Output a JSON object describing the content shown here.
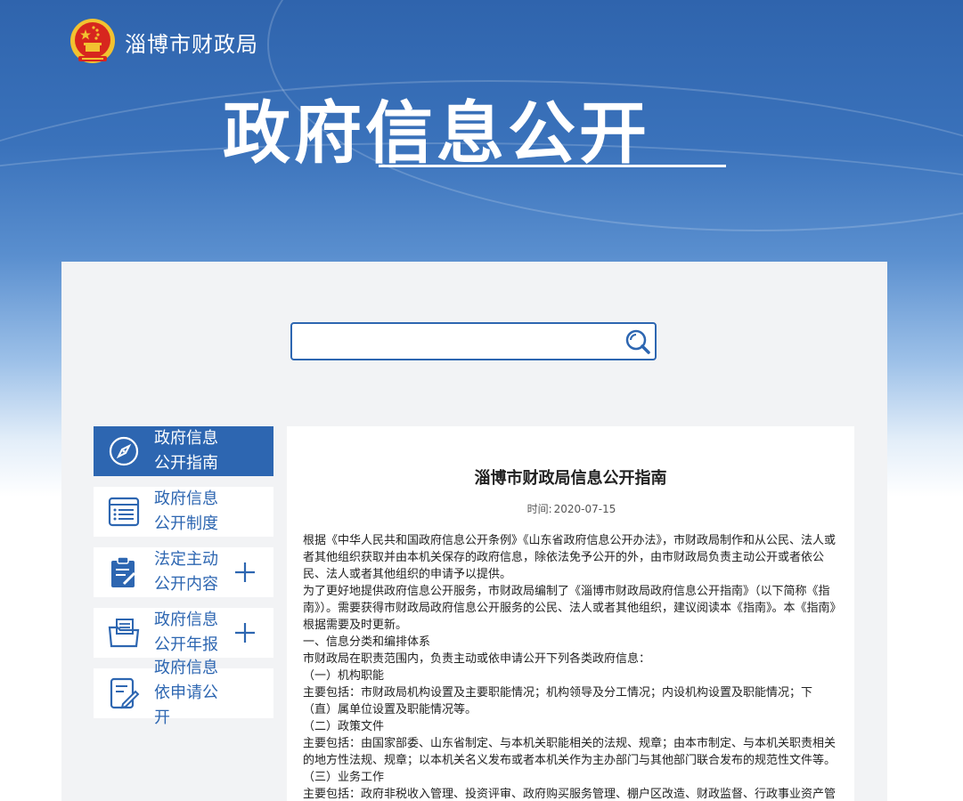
{
  "header": {
    "site_name": "淄博市财政局",
    "main_title": "政府信息公开"
  },
  "search": {
    "value": "",
    "placeholder": ""
  },
  "sidebar": {
    "items": [
      {
        "line1": "政府信息",
        "line2": "公开指南",
        "icon": "compass-icon",
        "active": true
      },
      {
        "line1": "政府信息",
        "line2": "公开制度",
        "icon": "list-document-icon"
      },
      {
        "line1": "法定主动",
        "line2": "公开内容",
        "icon": "clipboard-pen-icon",
        "expandable": true
      },
      {
        "line1": "政府信息",
        "line2": "公开年报",
        "icon": "folder-document-icon",
        "expandable": true
      },
      {
        "line1": "政府信息",
        "line2": "依申请公开",
        "icon": "form-pen-icon"
      }
    ]
  },
  "article": {
    "title": "淄博市财政局信息公开指南",
    "time_label": "时间:",
    "time_value": "2020-07-15",
    "paragraphs": [
      "根据《中华人民共和国政府信息公开条例》《山东省政府信息公开办法》，市财政局制作和从公民、法人或者其他组织获取并由本机关保存的政府信息，除依法免予公开的外，由市财政局负责主动公开或者依公民、法人或者其他组织的申请予以提供。",
      "为了更好地提供政府信息公开服务，市财政局编制了《淄博市财政局政府信息公开指南》（以下简称《指南》）。需要获得市财政局政府信息公开服务的公民、法人或者其他组织，建议阅读本《指南》。本《指南》根据需要及时更新。",
      "一、信息分类和编排体系",
      "市财政局在职责范围内，负责主动或依申请公开下列各类政府信息：",
      "（一）机构职能",
      "主要包括：市财政局机构设置及主要职能情况；机构领导及分工情况；内设机构设置及职能情况；下（直）属单位设置及职能情况等。",
      "（二）政策文件",
      "主要包括：由国家部委、山东省制定、与本机关职能相关的法规、规章；由本市制定、与本机关职责相关的地方性法规、规章；以本机关名义发布或者本机关作为主办部门与其他部门联合发布的规范性文件等。",
      "（三）业务工作",
      "主要包括：政府非税收入管理、投资评审、政府购买服务管理、棚户区改造、财政监督、行政事业资产管"
    ]
  },
  "colors": {
    "primary_blue": "#2d66b1",
    "panel_bg": "#f2f3f5",
    "emblem_red": "#d7261e",
    "emblem_gold": "#f2c230"
  }
}
